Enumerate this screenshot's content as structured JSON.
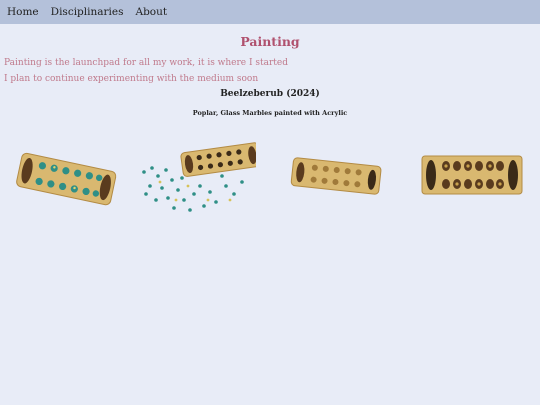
{
  "nav": {
    "items": [
      {
        "label": "Home"
      },
      {
        "label": "Disciplinaries"
      },
      {
        "label": "About"
      }
    ]
  },
  "page": {
    "title": "Painting",
    "paragraphs": [
      "Painting is the launchpad for all my work, it is where I started",
      "I plan to continue experimenting with the medium soon"
    ]
  },
  "artwork": {
    "title": "Beelzeberub (2024)",
    "medium": "Poplar, Glass Marbles painted with Acrylic"
  },
  "colors": {
    "nav_bg": "#b4c1da",
    "page_bg": "#e8ecf7",
    "title": "#b0516e",
    "body_text": "#c07a8c",
    "wood": "#d9b870",
    "marble": "#2f8f86"
  },
  "gallery": [
    {
      "icon": "mancala-board-photo-angled"
    },
    {
      "icon": "mancala-board-photo-scattered-marbles"
    },
    {
      "icon": "mancala-board-photo-side"
    },
    {
      "icon": "mancala-board-photo-top"
    }
  ]
}
